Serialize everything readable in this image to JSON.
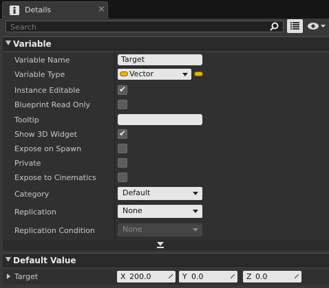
{
  "tab": {
    "title": "Details",
    "icon": "info-icon",
    "close": "×"
  },
  "search": {
    "placeholder": "Search",
    "value": ""
  },
  "toolbar": {
    "property_matrix_icon": "property-matrix-icon",
    "visibility_icon": "eye-icon"
  },
  "variable_section": {
    "title": "Variable",
    "rows": {
      "variable_name": {
        "label": "Variable Name",
        "value": "Target"
      },
      "variable_type": {
        "label": "Variable Type",
        "value": "Vector"
      },
      "instance_editable": {
        "label": "Instance Editable",
        "checked": true
      },
      "blueprint_read_only": {
        "label": "Blueprint Read Only",
        "checked": false
      },
      "tooltip": {
        "label": "Tooltip",
        "value": ""
      },
      "show_3d_widget": {
        "label": "Show 3D Widget",
        "checked": true
      },
      "expose_on_spawn": {
        "label": "Expose on Spawn",
        "checked": false
      },
      "private": {
        "label": "Private",
        "checked": false
      },
      "expose_to_cinematics": {
        "label": "Expose to Cinematics",
        "checked": false
      },
      "category": {
        "label": "Category",
        "value": "Default"
      },
      "replication": {
        "label": "Replication",
        "value": "None"
      },
      "replication_condition": {
        "label": "Replication Condition",
        "value": "None"
      }
    }
  },
  "default_value_section": {
    "title": "Default Value",
    "target": {
      "label": "Target",
      "x_label": "X",
      "x": "200.0",
      "y_label": "Y",
      "y": "0.0",
      "z_label": "Z",
      "z": "0.0"
    }
  },
  "colors": {
    "accent_pin": "#e8b400",
    "panel": "#383838",
    "row": "#303030"
  }
}
